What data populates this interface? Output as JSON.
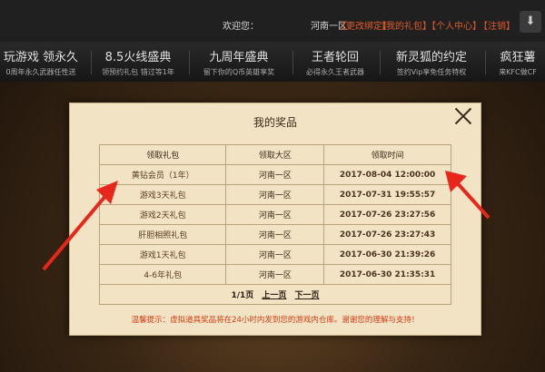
{
  "topbar": {
    "welcome": "欢迎您：",
    "region": "河南一区",
    "change_binding": "【更改绑定】",
    "my_gifts": "【我的礼包】",
    "personal_center": "【个人中心】",
    "logout": "【注销】"
  },
  "nav": [
    {
      "title": "玩游戏 领永久",
      "sub": "0周年永久武器任性送"
    },
    {
      "title": "8.5火线盛典",
      "sub": "领预约礼包 错过等1年"
    },
    {
      "title": "九周年盛典",
      "sub": "留下你的Q币英雄享奖"
    },
    {
      "title": "王者轮回",
      "sub": "必得永久王者武器"
    },
    {
      "title": "新灵狐的约定",
      "sub": "签约Vip享免任务特权"
    },
    {
      "title": "疯狂薯",
      "sub": "来KFC做CF"
    }
  ],
  "modal": {
    "title": "我的奖品",
    "headers": [
      "领取礼包",
      "领取大区",
      "领取时间"
    ],
    "rows": [
      [
        "黄钻会员（1年）",
        "河南一区",
        "2017-08-04 12:00:00"
      ],
      [
        "游戏3天礼包",
        "河南一区",
        "2017-07-31 19:55:57"
      ],
      [
        "游戏2天礼包",
        "河南一区",
        "2017-07-26 23:27:56"
      ],
      [
        "肝胆相照礼包",
        "河南一区",
        "2017-07-26 23:27:43"
      ],
      [
        "游戏1天礼包",
        "河南一区",
        "2017-06-30 21:39:26"
      ],
      [
        "4-6年礼包",
        "河南一区",
        "2017-06-30 21:35:31"
      ]
    ],
    "pager": {
      "page": "1/1页",
      "prev": "上一页",
      "next": "下一页"
    },
    "notice": "温馨提示：虚拟道具奖品将在24小时内发到您的游戏内仓库。谢谢您的理解与支持！"
  },
  "colors": {
    "arrow": "#e8261b",
    "notice": "#d43b14"
  }
}
